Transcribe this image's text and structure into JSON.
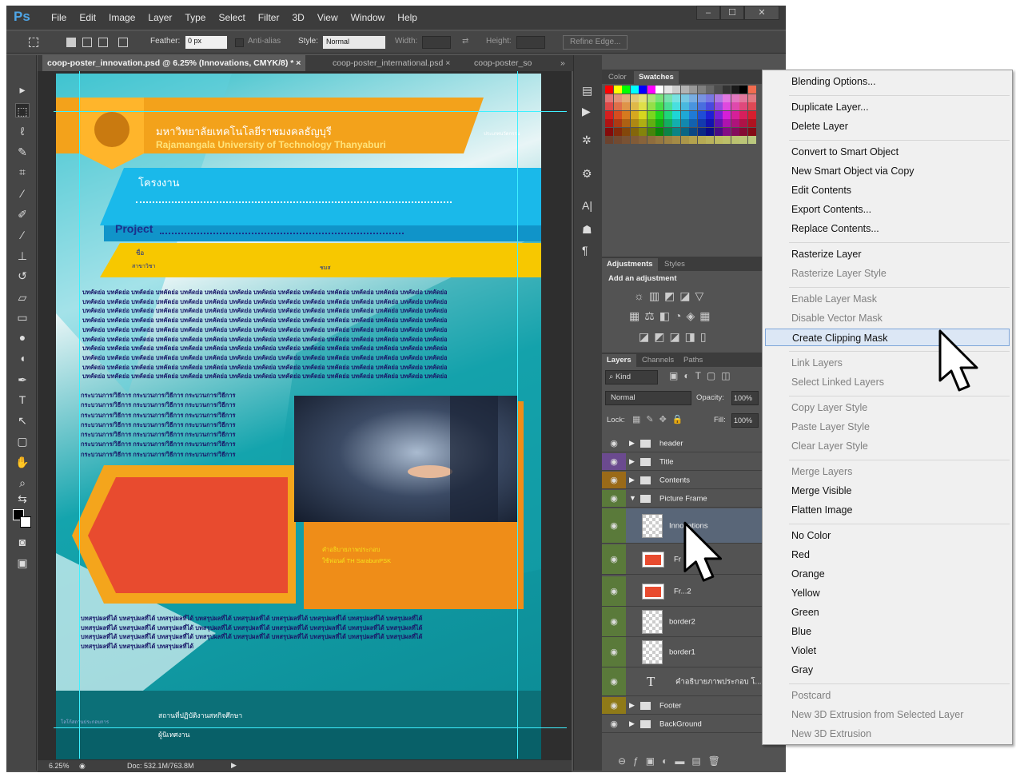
{
  "app": {
    "logo": "Ps",
    "menu": [
      "File",
      "Edit",
      "Image",
      "Layer",
      "Type",
      "Select",
      "Filter",
      "3D",
      "View",
      "Window",
      "Help"
    ],
    "window_buttons": [
      "‒",
      "☐",
      "✕"
    ]
  },
  "options_bar": {
    "feather_label": "Feather:",
    "feather_value": "0 px",
    "antialias_label": "Anti-alias",
    "style_label": "Style:",
    "style_value": "Normal",
    "width_label": "Width:",
    "height_label": "Height:",
    "refine_label": "Refine Edge..."
  },
  "doc_tabs": [
    "coop-poster_innovation.psd @ 6.25% (Innovations, CMYK/8) *",
    "coop-poster_international.psd",
    "coop-poster_so"
  ],
  "status": {
    "zoom": "6.25%",
    "doc": "Doc: 532.1M/763.8M"
  },
  "poster": {
    "univ_th": "มหาวิทยาลัยเทคโนโลยีราชมงคลธัญบุรี",
    "univ_en": "Rajamangala University of Technology Thanyaburi",
    "corner_label": "ประเภทนวัตกรรม",
    "project_th": "โครงงาน",
    "project_en": "Project",
    "name_label": "ชื่อ",
    "major_label": "สาขาวิชา",
    "year_label": "ชมส",
    "abstract_word": "บทคัดย่อ",
    "process_word": "กระบวนการ/วิธีการ",
    "caption1": "คำอธิบายภาพประกอบ",
    "caption2": "ใช้ฟอนต์ TH SarabunPSK",
    "conclusion_word": "บทสรุปผลที่ได้",
    "footer_place": "สถานที่ปฏิบัติงานสหกิจศึกษา",
    "footer_advisor": "ผู้นิเทศงาน",
    "footer_left": "โลโก้สถานประกอบการ"
  },
  "right_panel": {
    "color_tabs": [
      "Color",
      "Swatches"
    ],
    "adj_tabs": [
      "Adjustments",
      "Styles"
    ],
    "add_adjustment": "Add an adjustment",
    "layer_tabs": [
      "Layers",
      "Channels",
      "Paths"
    ],
    "kind_label": "Kind",
    "blend_mode": "Normal",
    "opacity_label": "Opacity:",
    "opacity_value": "100%",
    "lock_label": "Lock:",
    "fill_label": "Fill:",
    "fill_value": "100%",
    "layers": [
      {
        "name": "header",
        "type": "group"
      },
      {
        "name": "Title",
        "type": "group"
      },
      {
        "name": "Contents",
        "type": "group"
      },
      {
        "name": "Picture Frame",
        "type": "group-open"
      },
      {
        "name": "Innovations",
        "type": "smart"
      },
      {
        "name": "Fr",
        "type": "shape"
      },
      {
        "name": "Fr...2",
        "type": "shape"
      },
      {
        "name": "border2",
        "type": "smart"
      },
      {
        "name": "border1",
        "type": "smart"
      },
      {
        "name": "คำอธิบายภาพประกอบ โ...",
        "type": "text"
      },
      {
        "name": "Footer",
        "type": "group"
      },
      {
        "name": "BackGround",
        "type": "group"
      }
    ]
  },
  "context_menu": [
    {
      "label": "Blending Options...",
      "enabled": true
    },
    {
      "sep": true
    },
    {
      "label": "Duplicate Layer...",
      "enabled": true
    },
    {
      "label": "Delete Layer",
      "enabled": true
    },
    {
      "sep": true
    },
    {
      "label": "Convert to Smart Object",
      "enabled": true
    },
    {
      "label": "New Smart Object via Copy",
      "enabled": true
    },
    {
      "label": "Edit Contents",
      "enabled": true
    },
    {
      "label": "Export Contents...",
      "enabled": true
    },
    {
      "label": "Replace Contents...",
      "enabled": true
    },
    {
      "sep": true
    },
    {
      "label": "Rasterize Layer",
      "enabled": true
    },
    {
      "label": "Rasterize Layer Style",
      "enabled": false
    },
    {
      "sep": true
    },
    {
      "label": "Enable Layer Mask",
      "enabled": false
    },
    {
      "label": "Disable Vector Mask",
      "enabled": false
    },
    {
      "label": "Create Clipping Mask",
      "enabled": true,
      "highlighted": true
    },
    {
      "sep": true
    },
    {
      "label": "Link Layers",
      "enabled": false
    },
    {
      "label": "Select Linked Layers",
      "enabled": false
    },
    {
      "sep": true
    },
    {
      "label": "Copy Layer Style",
      "enabled": false
    },
    {
      "label": "Paste Layer Style",
      "enabled": false
    },
    {
      "label": "Clear Layer Style",
      "enabled": false
    },
    {
      "sep": true
    },
    {
      "label": "Merge Layers",
      "enabled": false
    },
    {
      "label": "Merge Visible",
      "enabled": true
    },
    {
      "label": "Flatten Image",
      "enabled": true
    },
    {
      "sep": true
    },
    {
      "label": "No Color",
      "enabled": true
    },
    {
      "label": "Red",
      "enabled": true
    },
    {
      "label": "Orange",
      "enabled": true
    },
    {
      "label": "Yellow",
      "enabled": true
    },
    {
      "label": "Green",
      "enabled": true
    },
    {
      "label": "Blue",
      "enabled": true
    },
    {
      "label": "Violet",
      "enabled": true
    },
    {
      "label": "Gray",
      "enabled": true
    },
    {
      "sep": true
    },
    {
      "label": "Postcard",
      "enabled": false
    },
    {
      "label": "New 3D Extrusion from Selected Layer",
      "enabled": false
    },
    {
      "label": "New 3D Extrusion",
      "enabled": false
    }
  ]
}
